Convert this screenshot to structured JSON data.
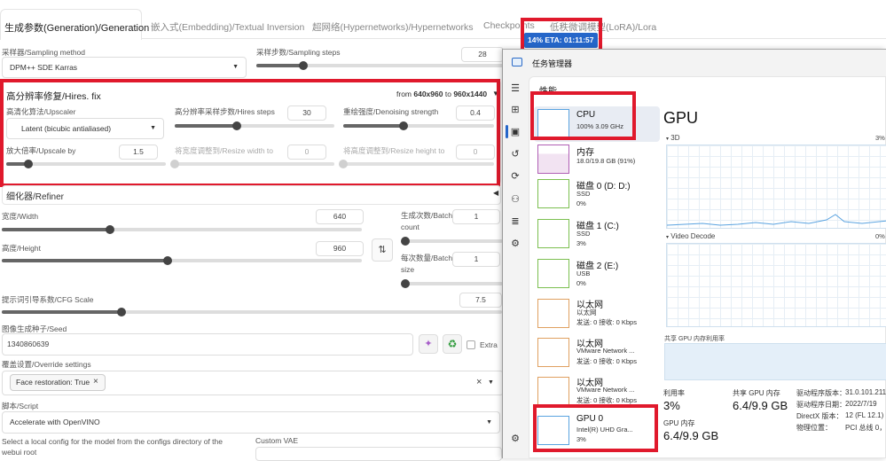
{
  "tabs": [
    {
      "label": "生成参数(Generation)/Generation"
    },
    {
      "label": "嵌入式(Embedding)/Textual Inversion"
    },
    {
      "label": "超网络(Hypernetworks)/Hypernetworks"
    },
    {
      "label": "Checkpoints"
    },
    {
      "label": "低秩微调模型(LoRA)/Lora"
    }
  ],
  "progress": {
    "text": "14% ETA: 01:11:57",
    "percent": 14
  },
  "sampling": {
    "method_label": "采样器/Sampling method",
    "method_value": "DPM++ SDE Karras",
    "steps_label": "采样步数/Sampling steps",
    "steps_value": "28"
  },
  "hires": {
    "title": "高分辨率修复/Hires. fix",
    "size_from": "from",
    "size_from_value": "640x960",
    "size_to": "to",
    "size_to_value": "960x1440",
    "upscaler_label": "高清化算法/Upscaler",
    "upscaler_value": "Latent (bicubic antialiased)",
    "steps_label": "高分辨率采样步数/Hires steps",
    "steps_value": "30",
    "denoise_label": "重绘强度/Denoising strength",
    "denoise_value": "0.4",
    "upscale_label": "放大倍率/Upscale by",
    "upscale_value": "1.5",
    "resize_w_label": "将宽度调整到/Resize width to",
    "resize_w_value": "0",
    "resize_h_label": "将高度调整到/Resize height to",
    "resize_h_value": "0"
  },
  "refiner": {
    "label": "细化器/Refiner"
  },
  "dims": {
    "width_label": "宽度/Width",
    "width_value": "640",
    "height_label": "高度/Height",
    "height_value": "960",
    "swap_icon": "swap-icon",
    "batch_count_label": "生成次数/Batch count",
    "batch_count_value": "1",
    "batch_size_label": "每次数量/Batch size",
    "batch_size_value": "1"
  },
  "cfg": {
    "label": "提示词引导系数/CFG Scale",
    "value": "7.5"
  },
  "seed": {
    "label": "图像生成种子/Seed",
    "value": "1340860639",
    "extra_label": "Extra"
  },
  "override": {
    "label": "覆盖设置/Override settings",
    "chip": "Face restoration: True",
    "chip_close": "×",
    "clear": "×"
  },
  "script": {
    "label": "脚本/Script",
    "value": "Accelerate with OpenVINO"
  },
  "config": {
    "text": "Select a local config for the model from the configs directory of the webui root",
    "vae_label": "Custom VAE"
  },
  "taskmgr": {
    "title": "任务管理器",
    "section": "性能",
    "items": [
      {
        "name": "CPU",
        "sub1": "100% 3.09 GHz",
        "sub2": ""
      },
      {
        "name": "内存",
        "sub1": "18.0/19.8 GB (91%)",
        "sub2": ""
      },
      {
        "name": "磁盘 0 (D: D:)",
        "sub1": "SSD",
        "sub2": "0%"
      },
      {
        "name": "磁盘 1 (C:)",
        "sub1": "SSD",
        "sub2": "3%"
      },
      {
        "name": "磁盘 2 (E:)",
        "sub1": "USB",
        "sub2": "0%"
      },
      {
        "name": "以太网",
        "sub1": "以太网",
        "sub2": "发送: 0 接收: 0 Kbps"
      },
      {
        "name": "以太网",
        "sub1": "VMware Network ...",
        "sub2": "发送: 0 接收: 0 Kbps"
      },
      {
        "name": "以太网",
        "sub1": "VMware Network ...",
        "sub2": "发送: 0 接收: 0 Kbps"
      },
      {
        "name": "GPU 0",
        "sub1": "Intel(R) UHD Gra...",
        "sub2": "3%"
      }
    ],
    "gpu": {
      "heading": "GPU",
      "engine1": "3D",
      "engine1_pct": "3%",
      "engine2": "Video Decode",
      "engine2_pct": "0%",
      "shared_label": "共享 GPU 内存利用率",
      "util_label": "利用率",
      "util_value": "3%",
      "shared_mem_label": "共享 GPU 内存",
      "shared_mem_value": "6.4/9.9 GB",
      "gpu_mem_label": "GPU 内存",
      "gpu_mem_value": "6.4/9.9 GB",
      "driver_ver_label": "驱动程序版本：",
      "driver_ver_value": "31.0.101.211",
      "driver_date_label": "驱动程序日期：",
      "driver_date_value": "2022/7/19",
      "directx_label": "DirectX 版本：",
      "directx_value": "12 (FL 12.1)",
      "phys_label": "物理位置：",
      "phys_value": "PCI 总线 0，"
    }
  },
  "sliders": {
    "sampling_steps": 0.19,
    "hires_steps": 0.39,
    "denoise": 0.4,
    "upscale": 0.14,
    "resize_w": 0.0,
    "resize_h": 0.0,
    "width": 0.3,
    "height": 0.46,
    "batch_count": 0.0,
    "batch_size": 0.0,
    "cfg": 0.24
  }
}
